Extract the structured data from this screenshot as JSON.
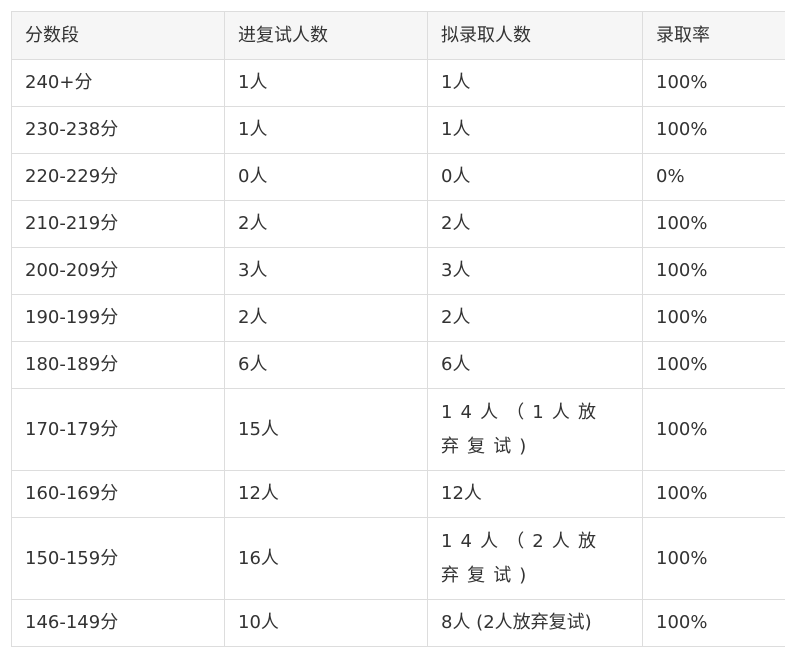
{
  "table": {
    "headers": [
      "分数段",
      "进复试人数",
      "拟录取人数",
      "录取率"
    ],
    "rows": [
      [
        "240+分",
        "1人",
        "1人",
        "100%"
      ],
      [
        "230-238分",
        "1人",
        "1人",
        "100%"
      ],
      [
        "220-229分",
        "0人",
        "0人",
        "0%"
      ],
      [
        "210-219分",
        "2人",
        "2人",
        "100%"
      ],
      [
        "200-209分",
        "3人",
        "3人",
        "100%"
      ],
      [
        "190-199分",
        "2人",
        "2人",
        "100%"
      ],
      [
        "180-189分",
        "6人",
        "6人",
        "100%"
      ],
      [
        "170-179分",
        "15人",
        "14人（1人放弃复试)",
        "100%"
      ],
      [
        "160-169分",
        "12人",
        "12人",
        "100%"
      ],
      [
        "150-159分",
        "16人",
        "14人（2人放弃复试)",
        "100%"
      ],
      [
        "146-149分",
        "10人",
        "8人 (2人放弃复试)",
        "100%"
      ]
    ]
  }
}
